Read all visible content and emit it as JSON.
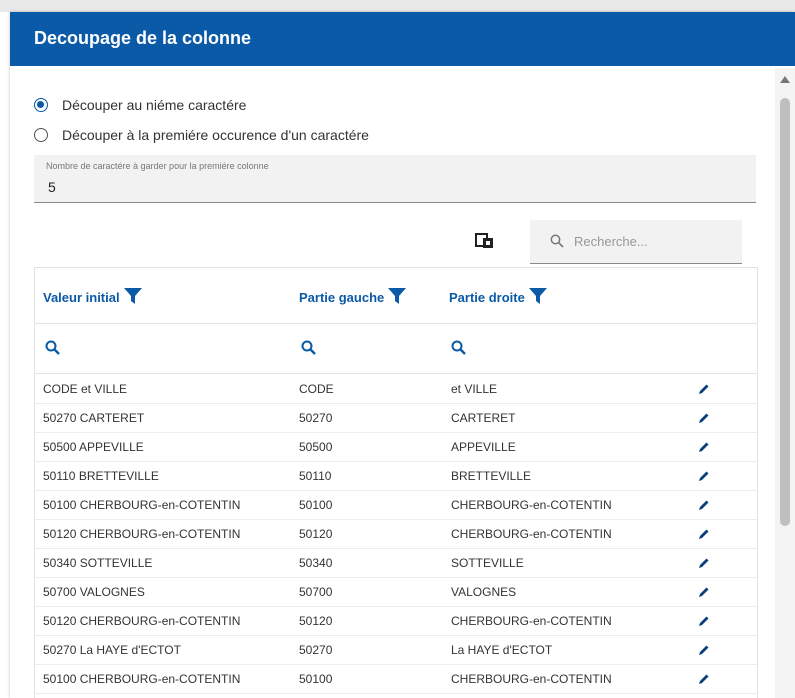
{
  "dialog": {
    "title": "Decoupage de la colonne"
  },
  "options": {
    "radio_nth": "Découper au niéme caractére",
    "radio_first": "Découper à la premiére occurence d'un caractére",
    "selected": "radio_nth"
  },
  "count_field": {
    "label": "Nombre de caractére à garder pour la premiére colonne",
    "value": "5"
  },
  "toolbar": {
    "search_placeholder": "Recherche..."
  },
  "table": {
    "headers": [
      "Valeur initial",
      "Partie gauche",
      "Partie droite"
    ],
    "rows": [
      [
        "CODE et VILLE",
        "CODE",
        "et VILLE"
      ],
      [
        "50270 CARTERET",
        "50270",
        "CARTERET"
      ],
      [
        "50500 APPEVILLE",
        "50500",
        "APPEVILLE"
      ],
      [
        "50110 BRETTEVILLE",
        "50110",
        "BRETTEVILLE"
      ],
      [
        "50100 CHERBOURG-en-COTENTIN",
        "50100",
        "CHERBOURG-en-COTENTIN"
      ],
      [
        "50120 CHERBOURG-en-COTENTIN",
        "50120",
        "CHERBOURG-en-COTENTIN"
      ],
      [
        "50340 SOTTEVILLE",
        "50340",
        "SOTTEVILLE"
      ],
      [
        "50700 VALOGNES",
        "50700",
        "VALOGNES"
      ],
      [
        "50120 CHERBOURG-en-COTENTIN",
        "50120",
        "CHERBOURG-en-COTENTIN"
      ],
      [
        "50270 La HAYE d'ECTOT",
        "50270",
        "La HAYE d'ECTOT"
      ],
      [
        "50100 CHERBOURG-en-COTENTIN",
        "50100",
        "CHERBOURG-en-COTENTIN"
      ]
    ]
  },
  "colors": {
    "accent": "#0b5aa8",
    "header_bg": "#0b5aa8",
    "field_bg": "#f2f2f2"
  },
  "icons": [
    "funnel-icon",
    "search-icon",
    "export-icon",
    "edit-icon"
  ]
}
